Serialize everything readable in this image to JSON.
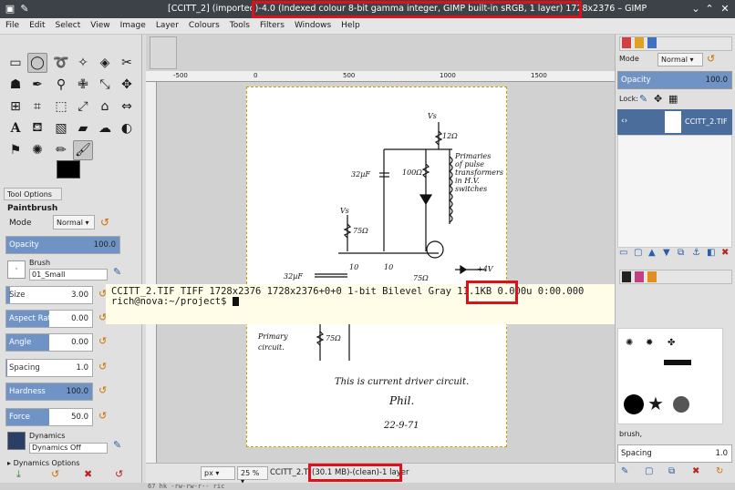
{
  "titlebar": {
    "title": "[CCITT_2] (imported)-4.0 (Indexed colour 8-bit gamma integer, GIMP built-in sRGB, 1 layer) 1728x2376 – GIMP",
    "title_lead": "[CCITT_2] (imported)-4.0",
    "title_highlight": "(Indexed colour 8-bit gamma integer, GIMP built-in sRGB, 1 layer) 1728x2376 – GIMP"
  },
  "menu": [
    "File",
    "Edit",
    "Select",
    "View",
    "Image",
    "Layer",
    "Colours",
    "Tools",
    "Filters",
    "Windows",
    "Help"
  ],
  "tool_options": {
    "tab_label": "Tool Options",
    "tool_name": "Paintbrush",
    "mode_label": "Mode",
    "mode_value": "Normal",
    "opacity_label": "Opacity",
    "opacity_value": "100.0",
    "brush_label": "Brush",
    "brush_name": "01_Small",
    "size_label": "Size",
    "size_value": "3.00",
    "aspect_label": "Aspect Ratio",
    "aspect_value": "0.00",
    "angle_label": "Angle",
    "angle_value": "0.00",
    "spacing_label": "Spacing",
    "spacing_value": "1.0",
    "hardness_label": "Hardness",
    "hardness_value": "100.0",
    "force_label": "Force",
    "force_value": "50.0",
    "dynamics_label": "Dynamics",
    "dynamics_value": "Dynamics Off",
    "dynamics_options": "Dynamics Options"
  },
  "ruler": {
    "top_labels": [
      "-500",
      "0",
      "500",
      "1000",
      "1500"
    ]
  },
  "schematic": {
    "vs1": "Vs",
    "r12": "12Ω",
    "primaries": [
      "Primaries",
      "of pulse",
      "transformers",
      "in H.V.",
      "switches"
    ],
    "c32a": "32µF",
    "r100": "100Ω",
    "vs2": "Vs",
    "r75a": "75Ω",
    "c32b": "32µF",
    "t10a": "10",
    "t10b": "10",
    "r75b": "75Ω",
    "plus4": "+4V",
    "primary": [
      "Primary",
      "circuit."
    ],
    "r75c": "75Ω",
    "caption": "This is current driver circuit.",
    "sign": "Phil.",
    "date": "22-9-71"
  },
  "terminal": {
    "line1_pre": "CCITT_2.TIF TIFF 1728x2376 1728x2376+0+0 1-bit Bilevel Gray ",
    "size": "11.1KB",
    "line1_post": " 0.000u 0:00.000",
    "prompt": "rich@nova:~/project$ "
  },
  "statusbar": {
    "unit": "px",
    "zoom": "25 %",
    "file": "CCITT_2.TIF",
    "info": "(30.1 MB)-(clean)-1 layer"
  },
  "bottom_hint": "67 hk -rw-rw-r-- ric",
  "layers": {
    "mode_label": "Mode",
    "mode_value": "Normal",
    "opacity_label": "Opacity",
    "opacity_value": "100.0",
    "lock_label": "Lock:",
    "layer_name": "CCITT_2.TIF"
  },
  "brushes": {
    "filter": "brush,",
    "spacing_label": "Spacing",
    "spacing_value": "1.0"
  },
  "colors": {
    "accent": "#6f93c4",
    "highlight": "#e0101a",
    "layer_row": "#4a6d9c"
  }
}
